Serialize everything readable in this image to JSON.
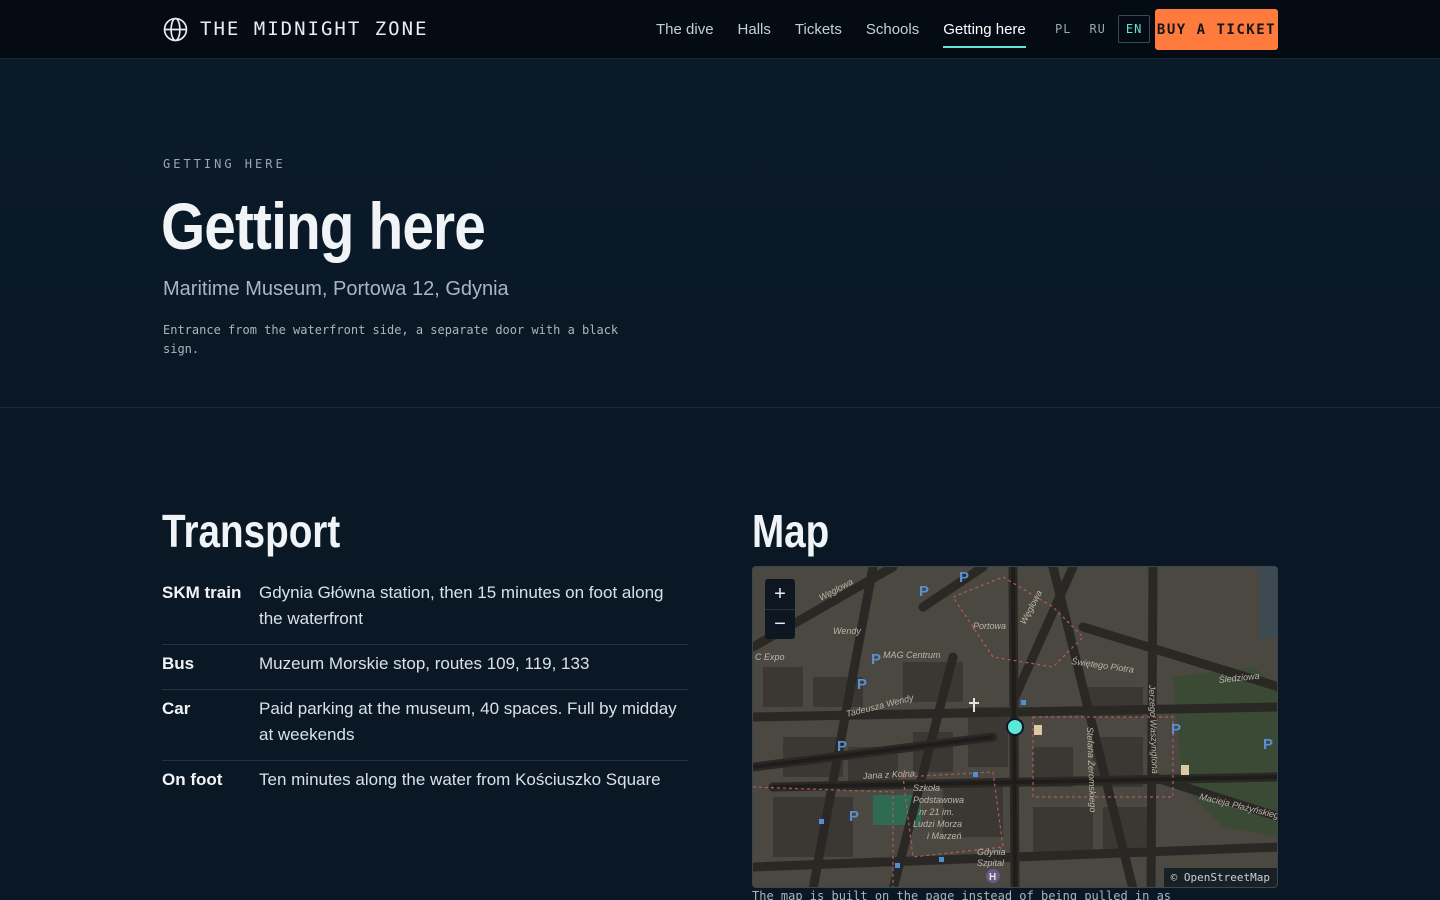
{
  "header": {
    "brand": "THE MIDNIGHT ZONE",
    "brand_icon": "globe-icon",
    "nav": [
      {
        "label": "The dive",
        "active": false
      },
      {
        "label": "Halls",
        "active": false
      },
      {
        "label": "Tickets",
        "active": false
      },
      {
        "label": "Schools",
        "active": false
      },
      {
        "label": "Getting here",
        "active": true
      }
    ],
    "languages": [
      {
        "code": "PL",
        "active": false
      },
      {
        "code": "RU",
        "active": false
      },
      {
        "code": "EN",
        "active": true
      }
    ],
    "cta": "BUY A TICKET"
  },
  "hero": {
    "eyebrow": "GETTING HERE",
    "title": "Getting here",
    "address": "Maritime Museum, Portowa 12, Gdynia",
    "note": "Entrance from the waterfront side, a separate door with a black sign."
  },
  "transport": {
    "title": "Transport",
    "rows": [
      {
        "mode": "SKM train",
        "desc": "Gdynia Główna station, then 15 minutes on foot along the waterfront"
      },
      {
        "mode": "Bus",
        "desc": "Muzeum Morskie stop, routes 109, 119, 133"
      },
      {
        "mode": "Car",
        "desc": "Paid parking at the museum, 40 spaces. Full by midday at weekends"
      },
      {
        "mode": "On foot",
        "desc": "Ten minutes along the water from Kościuszko Square"
      }
    ]
  },
  "map": {
    "title": "Map",
    "zoom_in": "+",
    "zoom_out": "−",
    "attribution": "© OpenStreetMap",
    "caption": "The map is built on the page instead of being pulled in as",
    "labels": {
      "weglowa": "Węglowa",
      "weglowa2": "Węglowa",
      "wendy": "Wendy",
      "portowa": "Portowa",
      "expo": "C Expo",
      "mag": "MAG Centrum",
      "swietego": "Świętego Piotra",
      "sledziowa": "Śledziowa",
      "tadeusza": "Tadeusza Wendy",
      "waszyngtona": "Jerzego Waszyngtona",
      "zeromskiego": "Stefana Żeromskiego",
      "kolna": "Jana z Kolna",
      "plazynskiego": "Macieja Płażyńskiego",
      "szkola1": "Szkoła",
      "szkola2": "Podstawowa",
      "szkola3": "nr 21 im.",
      "szkola4": "Ludzi Morza",
      "szkola5": "i Marzeń",
      "szpital1": "Gdynia",
      "szpital2": "Szpital"
    },
    "colors": {
      "pin": "#5ee6d6",
      "accent": "#ff7a3d"
    }
  }
}
